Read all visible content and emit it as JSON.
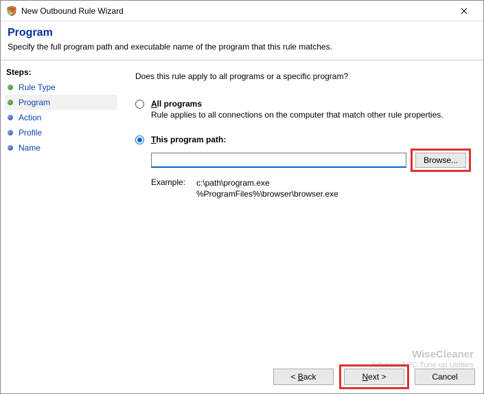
{
  "window": {
    "title": "New Outbound Rule Wizard"
  },
  "header": {
    "title": "Program",
    "subtitle": "Specify the full program path and executable name of the program that this rule matches."
  },
  "sidebar": {
    "title": "Steps:",
    "items": [
      {
        "label": "Rule Type",
        "state": "done"
      },
      {
        "label": "Program",
        "state": "done",
        "current": true
      },
      {
        "label": "Action",
        "state": "todo"
      },
      {
        "label": "Profile",
        "state": "todo"
      },
      {
        "label": "Name",
        "state": "todo"
      }
    ]
  },
  "content": {
    "question": "Does this rule apply to all programs or a specific program?",
    "all_programs": {
      "prefix": "A",
      "rest": "ll programs",
      "desc": "Rule applies to all connections on the computer that match other rule properties."
    },
    "this_path": {
      "prefix": "T",
      "rest": "his program path:",
      "value": "",
      "browse": "Browse...",
      "example_label": "Example:",
      "example_line1": "c:\\path\\program.exe",
      "example_line2": "%ProgramFiles%\\browser\\browser.exe"
    }
  },
  "footer": {
    "back_prefix": "< ",
    "back_ul": "B",
    "back_rest": "ack",
    "next_ul": "N",
    "next_rest": "ext >",
    "cancel": "Cancel"
  },
  "watermark": {
    "brand": "WiseCleaner",
    "tag": "Advanced PC Tune-up Utilities"
  }
}
